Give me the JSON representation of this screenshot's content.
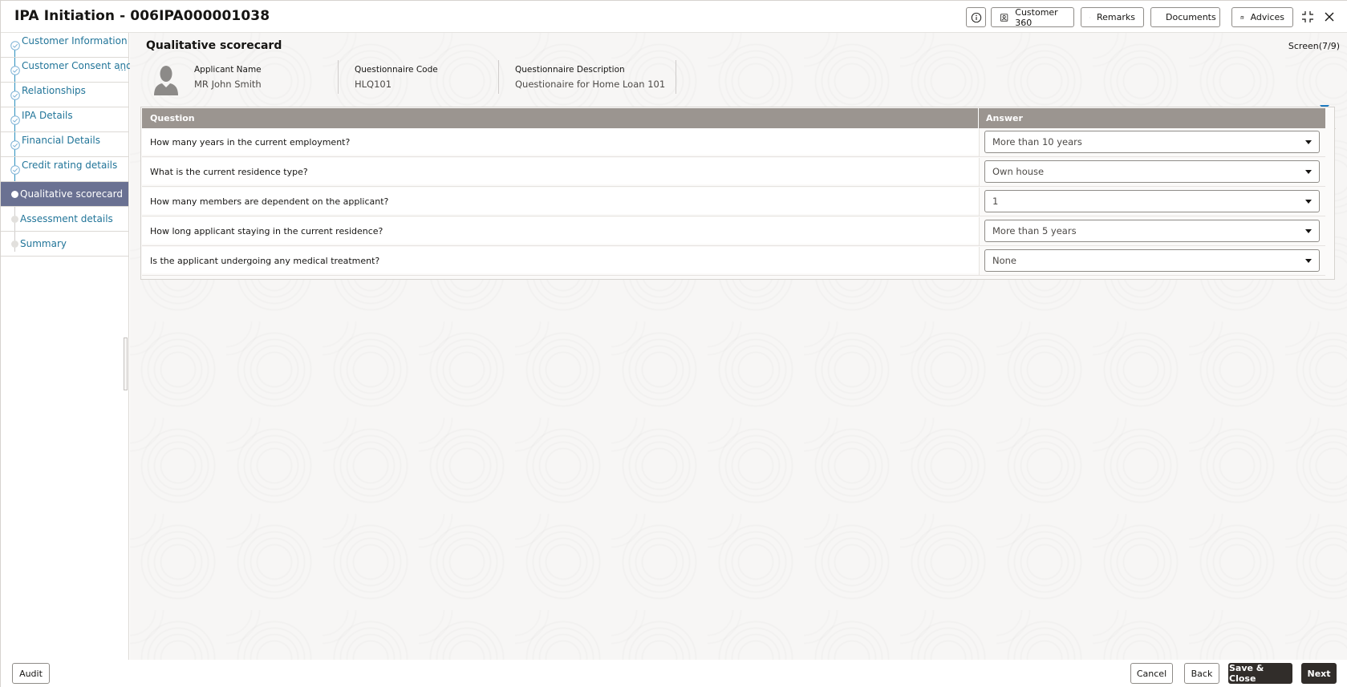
{
  "window": {
    "title": "IPA Initiation - 006IPA000001038",
    "toolbar": [
      {
        "id": "info",
        "label": "",
        "icon": "info-icon"
      },
      {
        "id": "customer360",
        "label": "Customer 360",
        "icon": "customer-icon"
      },
      {
        "id": "remarks",
        "label": "Remarks",
        "icon": "chat-icon"
      },
      {
        "id": "documents",
        "label": "Documents",
        "icon": "document-icon"
      },
      {
        "id": "advices",
        "label": "Advices",
        "icon": "advices-icon"
      }
    ],
    "controls": {
      "fullscreen_icon": "fullscreen-icon",
      "close_icon": "close-icon"
    }
  },
  "sidebar": {
    "items": [
      {
        "label": "Customer Information",
        "state": "done"
      },
      {
        "label": "Customer Consent and",
        "state": "done",
        "truncated": "..."
      },
      {
        "label": "Relationships",
        "state": "done"
      },
      {
        "label": "IPA Details",
        "state": "done"
      },
      {
        "label": "Financial Details",
        "state": "done"
      },
      {
        "label": "Credit rating details",
        "state": "done"
      },
      {
        "label": "Qualitative scorecard",
        "state": "active"
      },
      {
        "label": "Assessment details",
        "state": "pending"
      },
      {
        "label": "Summary",
        "state": "pending"
      }
    ]
  },
  "main": {
    "section_title": "Qualitative scorecard",
    "screen_counter": "Screen(7/9)",
    "applicant": {
      "name_label": "Applicant Name",
      "name_value": "MR John Smith",
      "code_label": "Questionnaire Code",
      "code_value": "HLQ101",
      "desc_label": "Questionnaire Description",
      "desc_value": "Questionaire for Home Loan 101"
    },
    "table": {
      "headers": {
        "question": "Question",
        "answer": "Answer"
      },
      "rows": [
        {
          "question": "How many years in the current employment?",
          "answer": "More than 10 years"
        },
        {
          "question": "What is the current residence type?",
          "answer": "Own house"
        },
        {
          "question": "How many members are dependent on the applicant?",
          "answer": "1"
        },
        {
          "question": "How long applicant staying in the current residence?",
          "answer": "More than 5 years"
        },
        {
          "question": "Is the applicant undergoing any medical treatment?",
          "answer": "None"
        }
      ]
    }
  },
  "footer": {
    "audit": "Audit",
    "cancel": "Cancel",
    "back": "Back",
    "save_close": "Save & Close",
    "next": "Next"
  },
  "colors": {
    "active_nav": "#6a7192",
    "link": "#227599",
    "table_header": "#9b9590",
    "primary_button": "#312d2a",
    "accent_caret": "#1e7bc1"
  }
}
